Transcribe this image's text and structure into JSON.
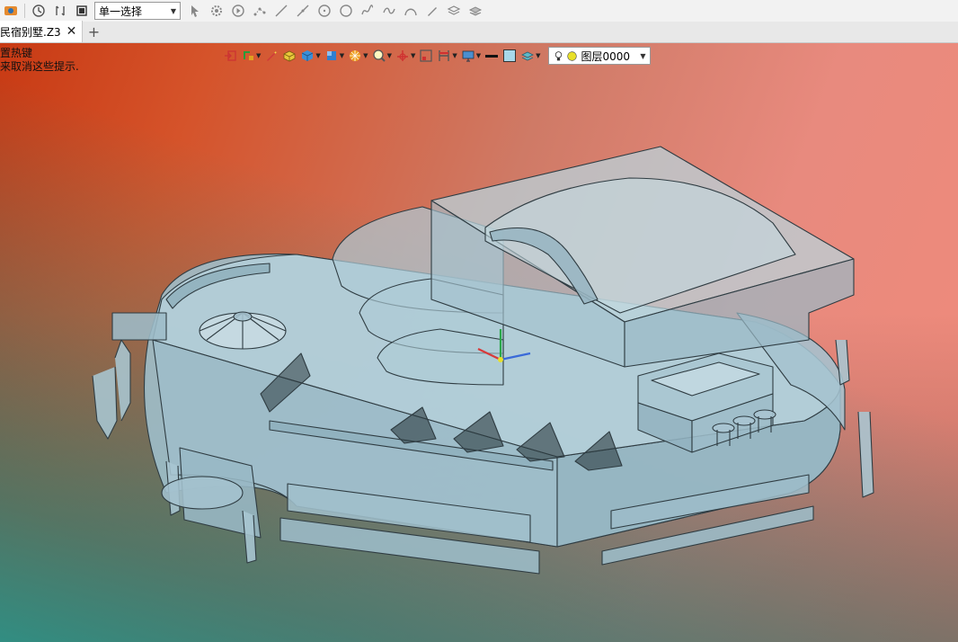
{
  "toolbar": {
    "selection_mode": "单一选择",
    "icons": [
      "app-logo-icon",
      "clock-icon",
      "filter-icon",
      "stop-icon",
      "pointer-icon",
      "gear-icon",
      "play-icon",
      "point-icon",
      "line-icon",
      "tangent-line-icon",
      "circle-icon",
      "point-circle-icon",
      "spline-icon",
      "curve-icon",
      "arc-icon",
      "pen-icon",
      "layers-icon",
      "stack-icon"
    ]
  },
  "tabs": [
    {
      "label": "民宿别墅.Z3"
    }
  ],
  "hint": {
    "line1": "置热键",
    "line2": "来取消这些提示."
  },
  "viewbar": {
    "layer_label": "图层0000",
    "icons": [
      "exit-icon",
      "move-icon",
      "pen-icon",
      "box-icon",
      "cube-icon",
      "view-cube-icon",
      "render-icon",
      "zoom-icon",
      "axis-icon",
      "frame-icon",
      "section-icon",
      "display-icon",
      "line-style-icon",
      "color-swatch-icon",
      "layer-stack-icon"
    ]
  },
  "colors": {
    "accent_yellow": "#e8e02a",
    "model_fill": "#a9c6d2",
    "model_line": "#2d3a40"
  }
}
